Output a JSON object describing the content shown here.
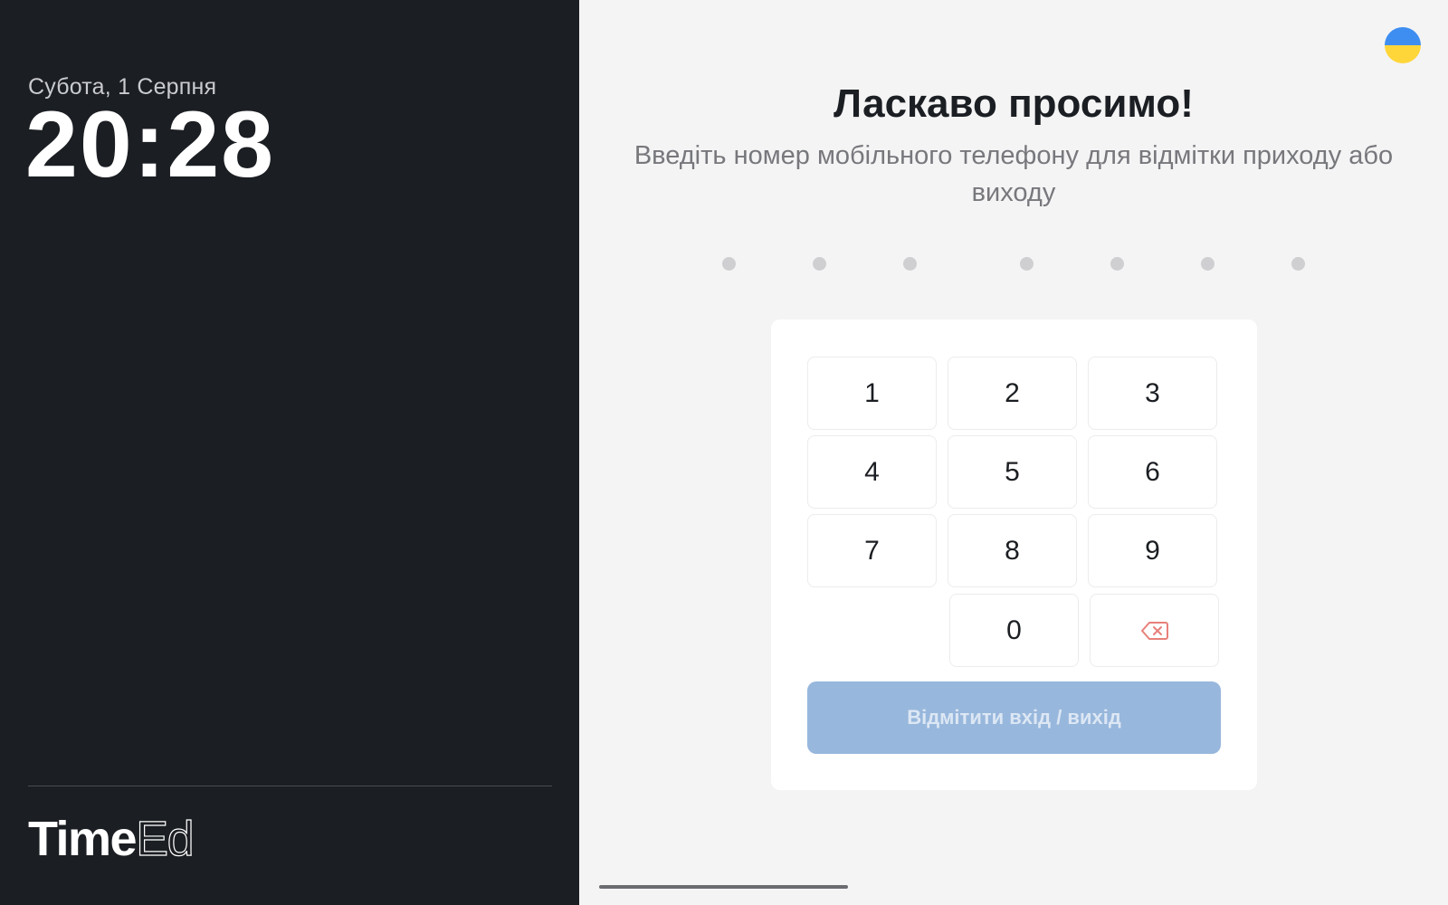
{
  "sidebar": {
    "date": "Субота, 1 Серпня",
    "time": "20:28",
    "logo_bold": "Time",
    "logo_thin": "Ed"
  },
  "header": {
    "language_flag": "ukraine-flag-icon",
    "title": "Ласкаво просимо!",
    "subtitle": "Введіть номер мобільного телефону для відмітки приходу або виходу"
  },
  "phone_input": {
    "digits_total": 7,
    "digits_entered": 0
  },
  "keypad": {
    "keys": [
      "1",
      "2",
      "3",
      "4",
      "5",
      "6",
      "7",
      "8",
      "9",
      "0"
    ],
    "backspace_icon": "backspace-icon",
    "backspace_color": "#e8807a",
    "submit_label": "Відмітити вхід / вихід"
  },
  "colors": {
    "sidebar_bg": "#1b1e22",
    "main_bg": "#f4f4f5",
    "submit_disabled": "#98b7dc"
  }
}
